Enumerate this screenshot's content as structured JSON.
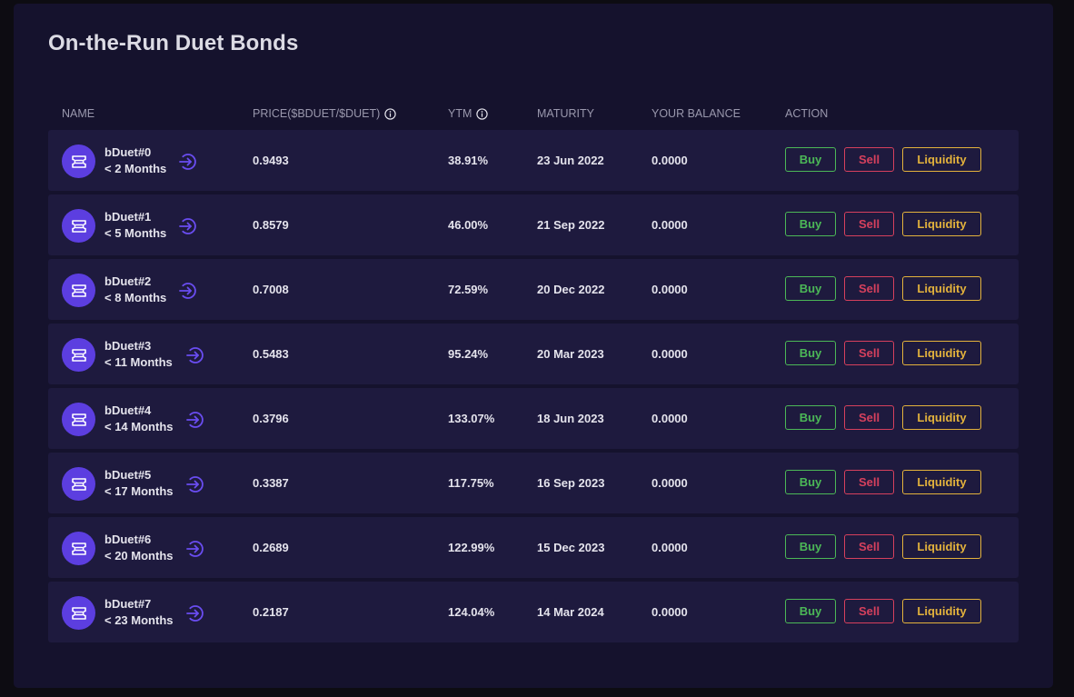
{
  "page": {
    "title": "On-the-Run Duet Bonds"
  },
  "table": {
    "columns": {
      "name": "NAME",
      "price": "PRICE($bDuet/$DUET)",
      "ytm": "YTM",
      "maturity": "MATURITY",
      "balance": "YOUR BALANCE",
      "action": "ACTION"
    },
    "actions": {
      "buy": "Buy",
      "sell": "Sell",
      "liquidity": "Liquidity"
    },
    "rows": [
      {
        "name": "bDuet#0",
        "term": "< 2 Months",
        "price": "0.9493",
        "ytm": "38.91%",
        "maturity": "23 Jun 2022",
        "balance": "0.0000"
      },
      {
        "name": "bDuet#1",
        "term": "< 5 Months",
        "price": "0.8579",
        "ytm": "46.00%",
        "maturity": "21 Sep 2022",
        "balance": "0.0000"
      },
      {
        "name": "bDuet#2",
        "term": "< 8 Months",
        "price": "0.7008",
        "ytm": "72.59%",
        "maturity": "20 Dec 2022",
        "balance": "0.0000"
      },
      {
        "name": "bDuet#3",
        "term": "< 11 Months",
        "price": "0.5483",
        "ytm": "95.24%",
        "maturity": "20 Mar 2023",
        "balance": "0.0000"
      },
      {
        "name": "bDuet#4",
        "term": "< 14 Months",
        "price": "0.3796",
        "ytm": "133.07%",
        "maturity": "18 Jun 2023",
        "balance": "0.0000"
      },
      {
        "name": "bDuet#5",
        "term": "< 17 Months",
        "price": "0.3387",
        "ytm": "117.75%",
        "maturity": "16 Sep 2023",
        "balance": "0.0000"
      },
      {
        "name": "bDuet#6",
        "term": "< 20 Months",
        "price": "0.2689",
        "ytm": "122.99%",
        "maturity": "15 Dec 2023",
        "balance": "0.0000"
      },
      {
        "name": "bDuet#7",
        "term": "< 23 Months",
        "price": "0.2187",
        "ytm": "124.04%",
        "maturity": "14 Mar 2024",
        "balance": "0.0000"
      }
    ]
  },
  "icons": {
    "token": "ticket-icon",
    "row_link": "arrow-circle-right-icon",
    "header_hint": "info-icon"
  },
  "colors": {
    "background": "#0d0c12",
    "panel": "#15122d",
    "row": "#1e1a3e",
    "accent": "#5c3ee0",
    "arrow": "#6a4df2",
    "buy": "#4cb857",
    "sell": "#d6405d",
    "liquidity": "#e3b23c",
    "header_text": "#9a98ad",
    "text": "#e4e3ec"
  }
}
